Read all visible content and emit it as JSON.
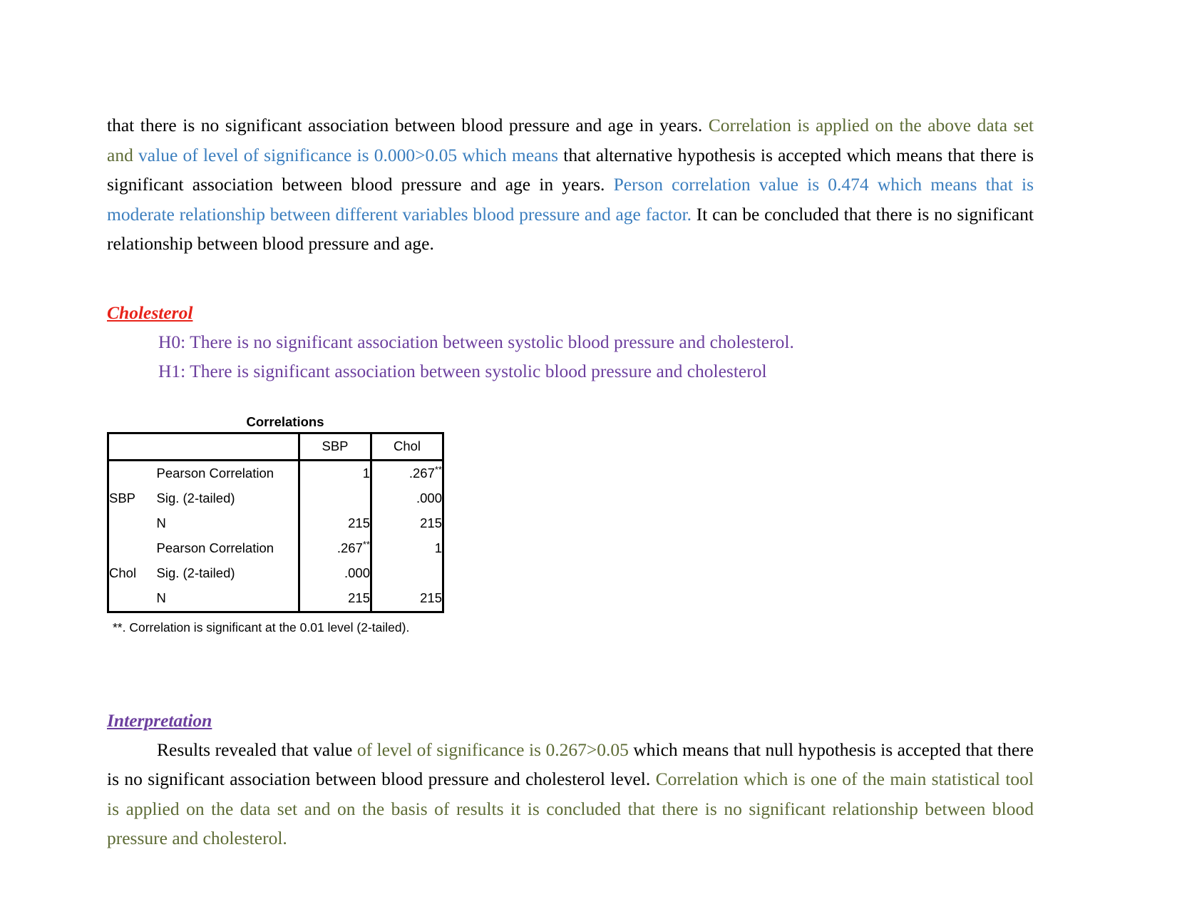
{
  "document": {
    "paragraph_1": {
      "segments": [
        {
          "text": "that there is no significant association between blood pressure and age in years. ",
          "color": "black"
        },
        {
          "text": "Correlation is applied on the above data set and ",
          "color": "olive"
        },
        {
          "text": "value of level of significance is 0.000>0.05 which means ",
          "color": "blue"
        },
        {
          "text": "that alternative hypothesis is accepted which means that there is significant association between blood pressure and age in years. ",
          "color": "black"
        },
        {
          "text": "Person correlation value is 0.474 which means that is moderate relationship between different variables blood pressure and age factor. ",
          "color": "blue"
        },
        {
          "text": "It can be concluded that there is no significant relationship between blood pressure and age.",
          "color": "black"
        }
      ]
    },
    "cholesterol_section": {
      "heading": "Cholesterol",
      "heading_color": "#e8231a",
      "hypotheses": [
        "H0: There is no significant association between systolic blood pressure and cholesterol.",
        "H1: There is significant association between systolic blood pressure and cholesterol"
      ]
    },
    "correlations_table": {
      "title": "Correlations",
      "column_headers": [
        "",
        "",
        "SBP",
        "Chol"
      ],
      "row_groups": [
        {
          "variable": "SBP",
          "rows": [
            {
              "statistic": "Pearson Correlation",
              "sbp": "1",
              "sbp_stars": "",
              "chol": ".267",
              "chol_stars": "**"
            },
            {
              "statistic": "Sig. (2-tailed)",
              "sbp": "",
              "sbp_stars": "",
              "chol": ".000",
              "chol_stars": ""
            },
            {
              "statistic": "N",
              "sbp": "215",
              "sbp_stars": "",
              "chol": "215",
              "chol_stars": ""
            }
          ]
        },
        {
          "variable": "Chol",
          "rows": [
            {
              "statistic": "Pearson Correlation",
              "sbp": ".267",
              "sbp_stars": "**",
              "chol": "1",
              "chol_stars": ""
            },
            {
              "statistic": "Sig. (2-tailed)",
              "sbp": ".000",
              "sbp_stars": "",
              "chol": "",
              "chol_stars": ""
            },
            {
              "statistic": "N",
              "sbp": "215",
              "sbp_stars": "",
              "chol": "215",
              "chol_stars": ""
            }
          ]
        }
      ],
      "footnote": "**. Correlation is significant at the 0.01 level (2-tailed)."
    },
    "interpretation_section": {
      "heading": "Interpretation",
      "heading_color": "#6c3f9e",
      "paragraph": {
        "segments": [
          {
            "text": "Results revealed that value ",
            "color": "black"
          },
          {
            "text": "of level of significance is 0.267>0.05 ",
            "color": "olive"
          },
          {
            "text": "which means that null hypothesis is accepted that there is no significant association between blood pressure and cholesterol level. ",
            "color": "black"
          },
          {
            "text": "Correlation which is one of the main statistical tool is applied on the data set and on the basis of results it is concluded that there is no significant relationship between blood pressure and cholesterol.",
            "color": "olive"
          }
        ]
      }
    }
  },
  "colors": {
    "black": "#000000",
    "blue": "#3b7ebe",
    "olive": "#5d6b35",
    "purple": "#6c3f9e",
    "red": "#e8231a"
  }
}
